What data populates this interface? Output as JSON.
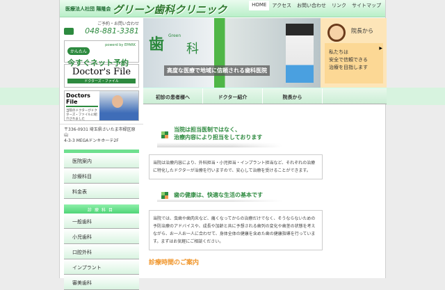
{
  "header": {
    "corp": "医療法人社団 陽隆会",
    "logo": "グリーン歯科クリニック",
    "nav": [
      "HOME",
      "アクセス",
      "お問い合わせ",
      "リンク",
      "サイトマップ"
    ]
  },
  "sidebar": {
    "phone_label": "ご予約・お問い合わせ",
    "phone": "048-881-3381",
    "epark": {
      "badge": "かんたん",
      "powered": "powerd by EPARK",
      "title": "今すぐネット予約"
    },
    "doctors_file": {
      "title": "Doctor's File",
      "sub": "ドクターズ・ファイル"
    },
    "doctors_file2": {
      "title": "Doctors File",
      "text": "当院のドクターがドクターズ・ファイルに紹介されました"
    },
    "address": [
      "〒336-0931 埼玉県さいたま市緑区原山",
      "4-3-3 MEGAドンキホーテ2F"
    ],
    "menu": [
      "医院案内",
      "診療科目",
      "料金表"
    ],
    "menu_header": "診療科目",
    "menu2": [
      "一般歯科",
      "小児歯科",
      "口腔外科",
      "インプラント",
      "審美歯科"
    ]
  },
  "hero": {
    "sign1": "歯",
    "sign_small": "Green",
    "sign2": "科",
    "caption": "高度な医療で地域に信頼される歯科医院",
    "director_title": "院長から",
    "director_msg": [
      "私たちは",
      "安全で信頼できる",
      "治療を目指します"
    ]
  },
  "tabs": [
    "初診の患者様へ",
    "ドクター紹介",
    "院長から"
  ],
  "content": {
    "h1": [
      "当院は担当医制ではなく、",
      "治療内容により担当をしております"
    ],
    "p1": "当院は治療内容により、外科担当・小児担当・インプラント担当など、それぞれの治療に特化したドクターが治療を行いますので、安心して治療を受けることができます。",
    "h2": "歯の健康は、快適な生活の基本です",
    "p2": "当院では、虫歯や歯肉炎など、痛くなってからの治療だけでなく、そうならないための予防治療のアドバイスや、成長や加齢と共に予想される歯列の変化や歯茎の状態を考えながら、お一人お一人に合わせて、身体全体の健康を含めた歯の健康指導を行っています。まずはお気軽にご相談ください。",
    "h3": "診療時間のご案内"
  }
}
